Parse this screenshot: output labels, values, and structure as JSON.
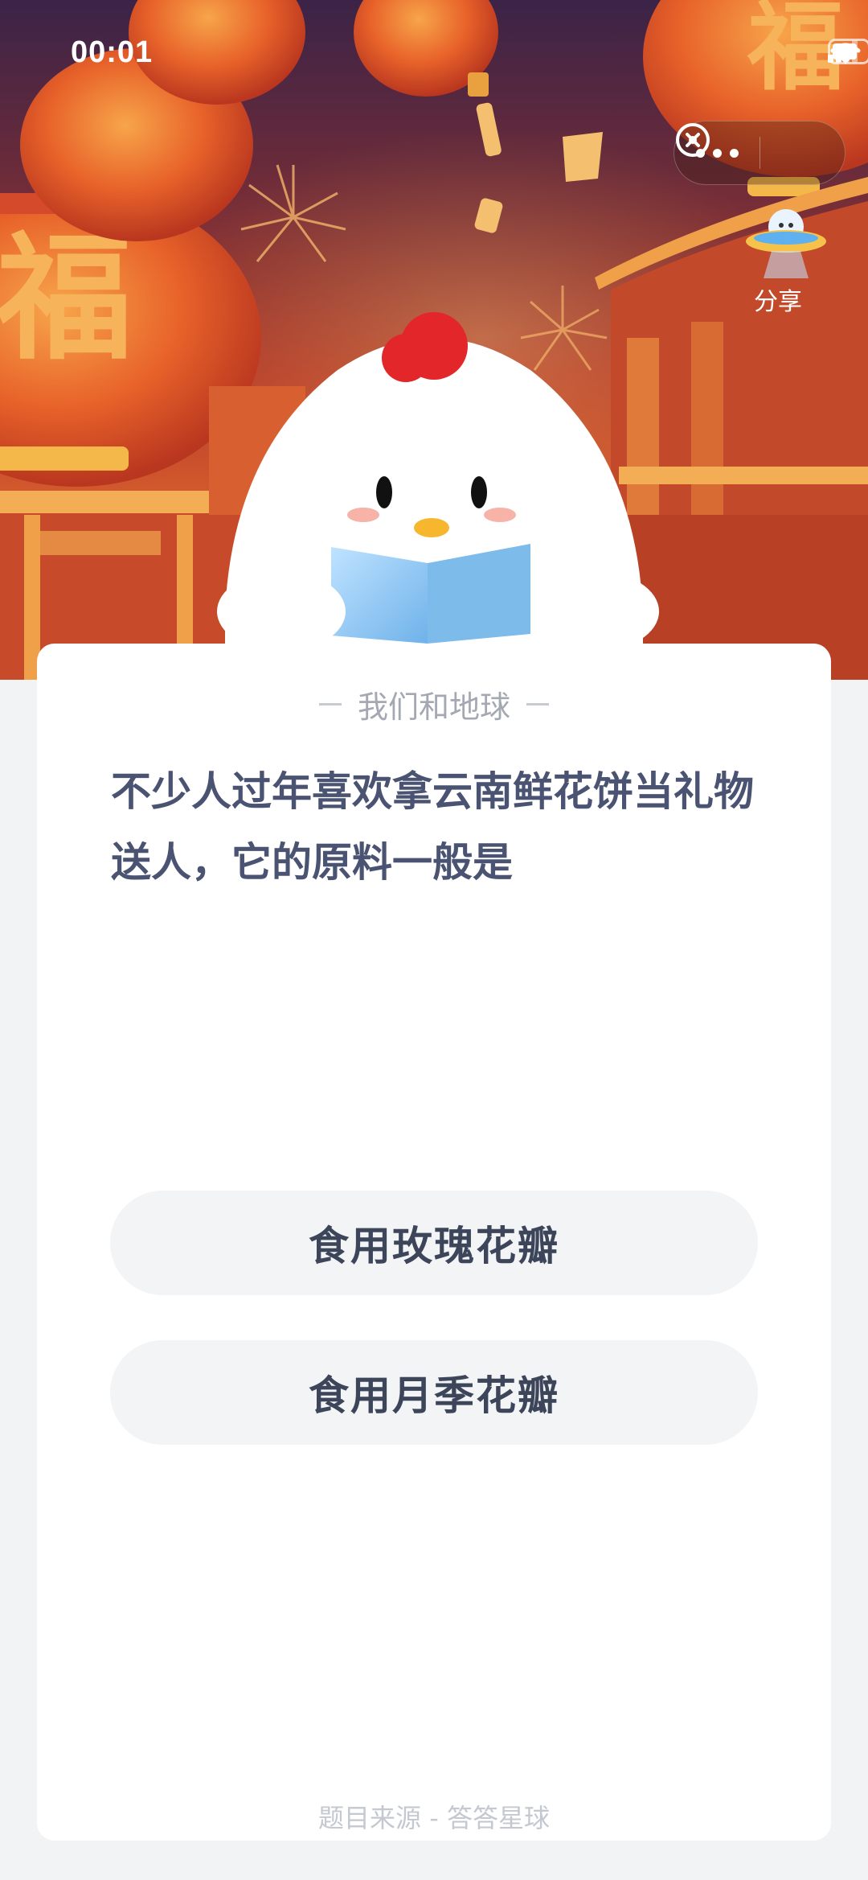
{
  "status_bar": {
    "time": "00:01",
    "icons": [
      "signal-icon",
      "wifi-icon",
      "battery-icon"
    ]
  },
  "capsule": {
    "more_icon": "more-dots-icon",
    "close_icon": "close-circle-icon"
  },
  "share": {
    "label": "分享",
    "icon": "ufo-mascot-icon"
  },
  "hero": {
    "lantern_text": "福",
    "decor": [
      "lanterns",
      "fireworks",
      "sky-lanterns",
      "chinese-gate",
      "chick-mascot-reading-book"
    ]
  },
  "quiz": {
    "category": "我们和地球",
    "question": "不少人过年喜欢拿云南鲜花饼当礼物送人，它的原料一般是",
    "options": [
      {
        "label": "食用玫瑰花瓣"
      },
      {
        "label": "食用月季花瓣"
      }
    ],
    "source": "题目来源 - 答答星球"
  },
  "colors": {
    "page_bg": "#f2f3f5",
    "card_bg": "#ffffff",
    "question_text": "#4a5472",
    "option_bg": "#f3f4f6",
    "option_text": "#3c4559",
    "hero_red": "#b33a2a",
    "lantern_orange": "#e8632a"
  }
}
